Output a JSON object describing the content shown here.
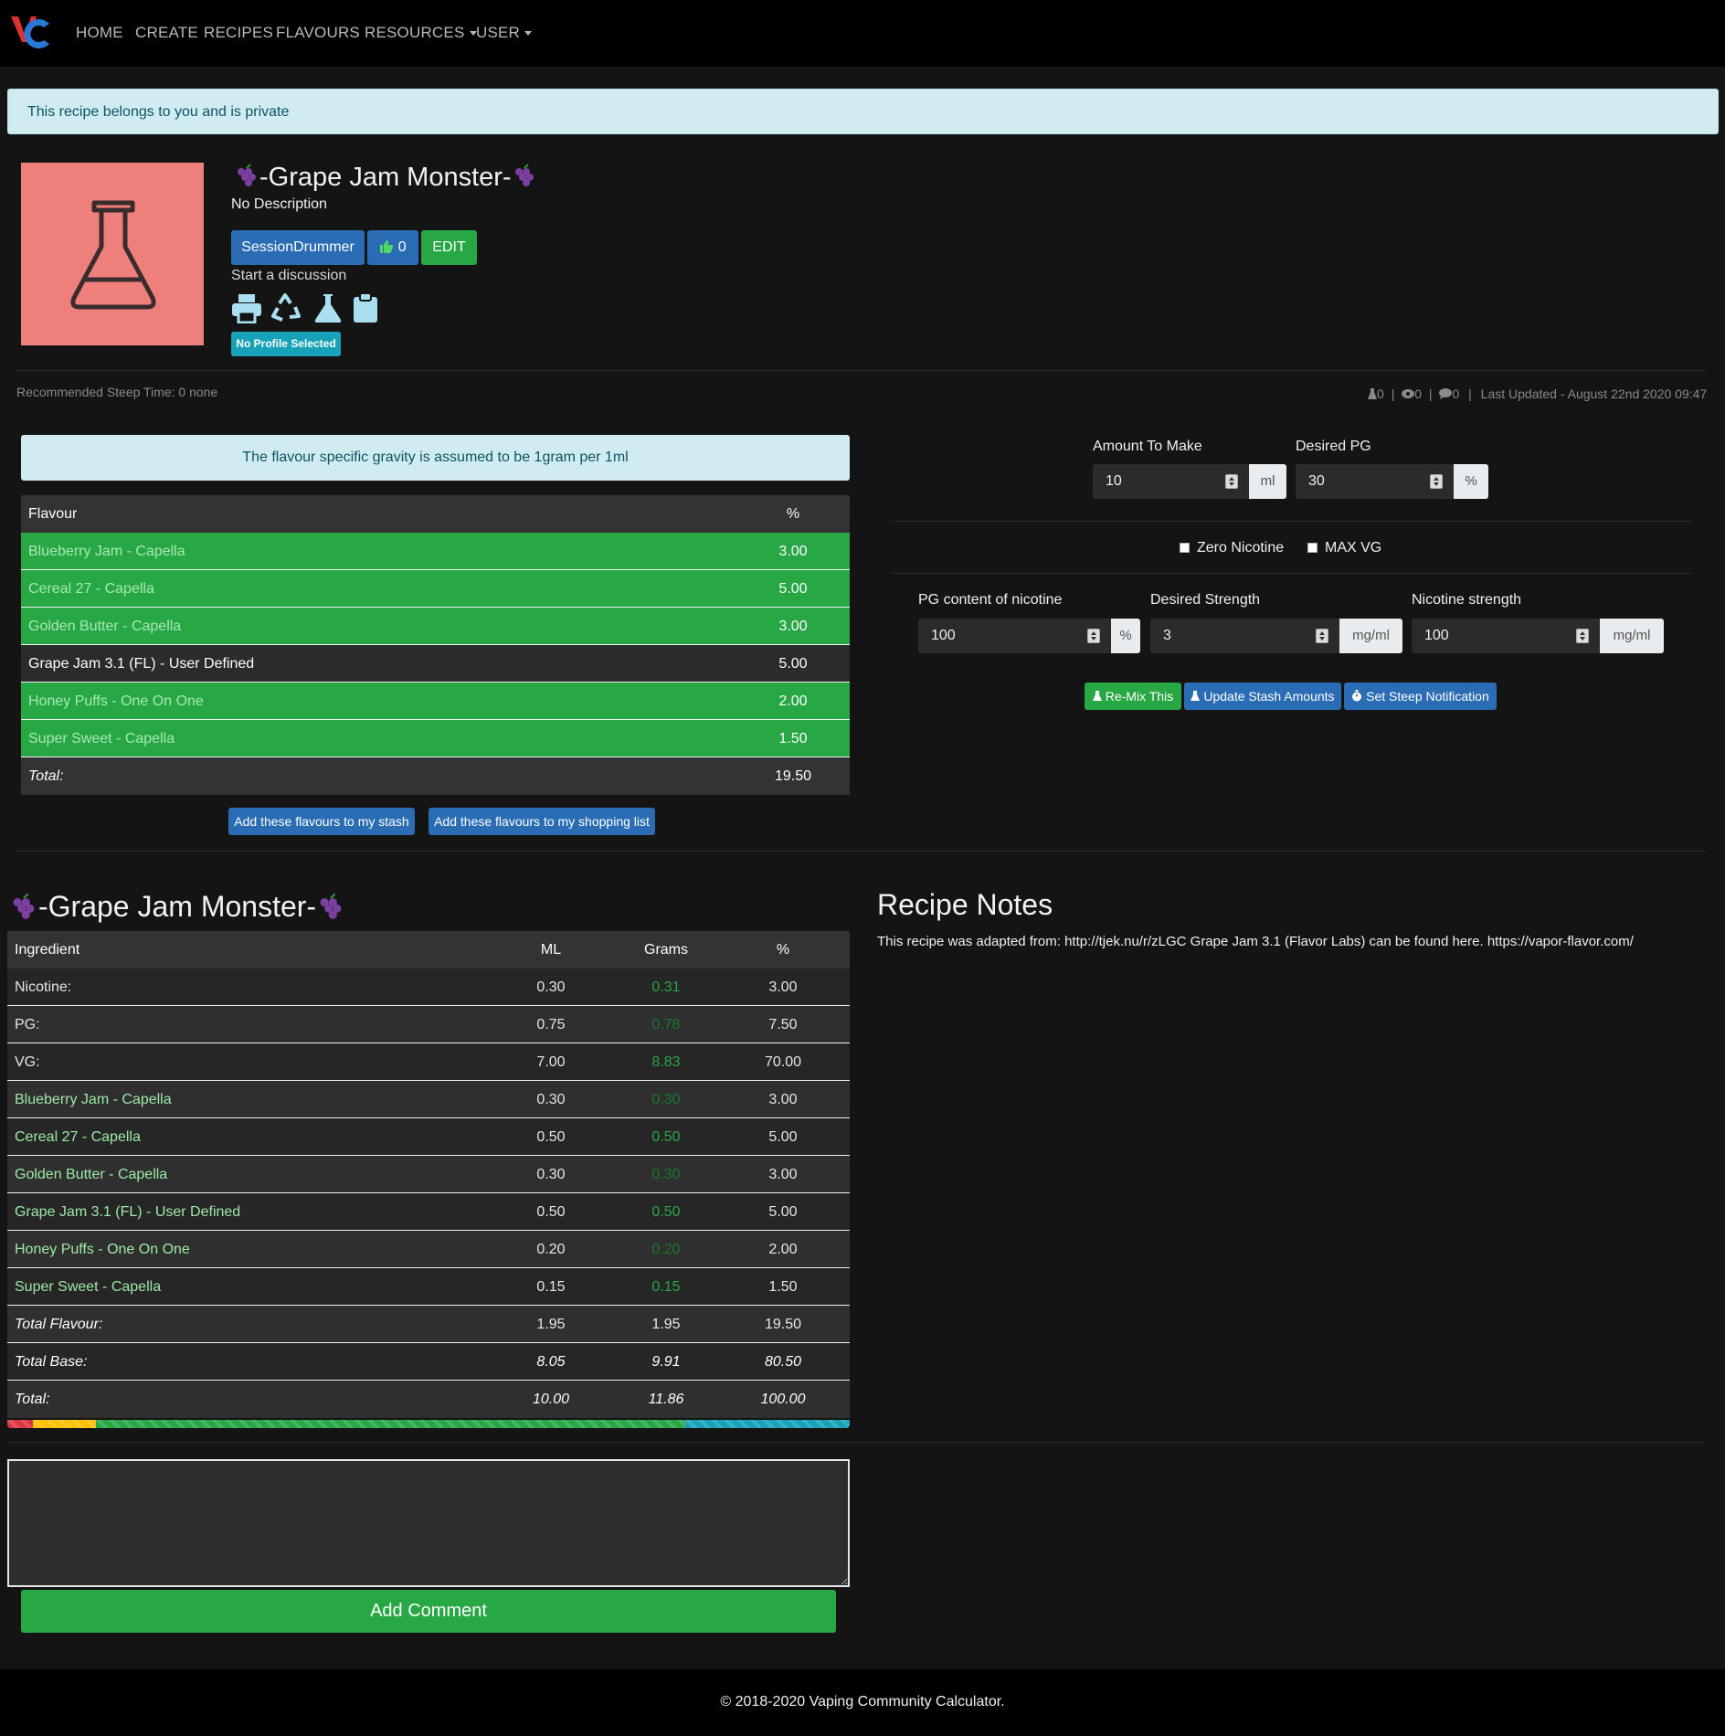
{
  "nav": {
    "items": [
      "HOME",
      "CREATE",
      "RECIPES",
      "FLAVOURS",
      "RESOURCES",
      "USER"
    ]
  },
  "alerts": {
    "private": "This recipe belongs to you and is private",
    "gravity": "The flavour specific gravity is assumed to be 1gram per 1ml"
  },
  "recipe": {
    "title": "-Grape Jam Monster-",
    "description": "No Description",
    "author": "SessionDrummer",
    "likes": "0",
    "edit_label": "EDIT",
    "discussion_link": "Start a discussion",
    "profile_badge": "No Profile Selected",
    "steep_time": "Recommended Steep Time: 0 none",
    "stats": {
      "made": "0",
      "views": "0",
      "comments": "0"
    },
    "last_updated": "Last Updated - August 22nd 2020 09:47"
  },
  "flavour_table": {
    "headers": [
      "Flavour",
      "%"
    ],
    "rows": [
      {
        "name": "Blueberry Jam - Capella",
        "pct": "3.00",
        "in_stash": true
      },
      {
        "name": "Cereal 27 - Capella",
        "pct": "5.00",
        "in_stash": true
      },
      {
        "name": "Golden Butter - Capella",
        "pct": "3.00",
        "in_stash": true
      },
      {
        "name": "Grape Jam 3.1 (FL) - User Defined",
        "pct": "5.00",
        "in_stash": false
      },
      {
        "name": "Honey Puffs - One On One",
        "pct": "2.00",
        "in_stash": true
      },
      {
        "name": "Super Sweet - Capella",
        "pct": "1.50",
        "in_stash": true
      }
    ],
    "total_label": "Total:",
    "total_value": "19.50",
    "add_stash_button": "Add these flavours to my stash",
    "add_shopping_button": "Add these flavours to my shopping list"
  },
  "calculator": {
    "amount_label": "Amount To Make",
    "amount_value": "10",
    "amount_unit": "ml",
    "pg_label": "Desired PG",
    "pg_value": "30",
    "pg_unit": "%",
    "zero_nicotine_label": "Zero Nicotine",
    "max_vg_label": "MAX VG",
    "nic_pg_label": "PG content of nicotine",
    "nic_pg_value": "100",
    "nic_pg_unit": "%",
    "strength_label": "Desired Strength",
    "strength_value": "3",
    "strength_unit": "mg/ml",
    "nic_strength_label": "Nicotine strength",
    "nic_strength_value": "100",
    "nic_strength_unit": "mg/ml",
    "remix_button": "Re-Mix This",
    "update_stash_button": "Update Stash Amounts",
    "steep_button": "Set Steep Notification"
  },
  "ingredients": {
    "title": "-Grape Jam Monster-",
    "headers": [
      "Ingredient",
      "ML",
      "Grams",
      "%"
    ],
    "base_rows": [
      {
        "name": "Nicotine:",
        "ml": "0.30",
        "grams": "0.31",
        "pct": "3.00"
      },
      {
        "name": "PG:",
        "ml": "0.75",
        "grams": "0.78",
        "pct": "7.50"
      },
      {
        "name": "VG:",
        "ml": "7.00",
        "grams": "8.83",
        "pct": "70.00"
      }
    ],
    "flavour_rows": [
      {
        "name": "Blueberry Jam - Capella",
        "ml": "0.30",
        "grams": "0.30",
        "pct": "3.00"
      },
      {
        "name": "Cereal 27 - Capella",
        "ml": "0.50",
        "grams": "0.50",
        "pct": "5.00"
      },
      {
        "name": "Golden Butter - Capella",
        "ml": "0.30",
        "grams": "0.30",
        "pct": "3.00"
      },
      {
        "name": "Grape Jam 3.1 (FL) - User Defined",
        "ml": "0.50",
        "grams": "0.50",
        "pct": "5.00"
      },
      {
        "name": "Honey Puffs - One On One",
        "ml": "0.20",
        "grams": "0.20",
        "pct": "2.00"
      },
      {
        "name": "Super Sweet - Capella",
        "ml": "0.15",
        "grams": "0.15",
        "pct": "1.50"
      }
    ],
    "totals": [
      {
        "name": "Total Flavour:",
        "ml": "1.95",
        "grams": "1.95",
        "pct": "19.50"
      },
      {
        "name": "Total Base:",
        "ml": "8.05",
        "grams": "9.91",
        "pct": "80.50"
      },
      {
        "name": "Total:",
        "ml": "10.00",
        "grams": "11.86",
        "pct": "100.00"
      }
    ],
    "mix_bar": [
      {
        "pct": 3.0,
        "color": "#dc3545"
      },
      {
        "pct": 7.5,
        "color": "#ffc107"
      },
      {
        "pct": 70.0,
        "color": "#28a745"
      },
      {
        "pct": 19.5,
        "color": "#17a2b8"
      }
    ]
  },
  "notes": {
    "title": "Recipe Notes",
    "text": "This recipe was adapted from: http://tjek.nu/r/zLGC Grape Jam 3.1 (Flavor Labs) can be found here. https://vapor-flavor.com/"
  },
  "comment": {
    "placeholder": "",
    "button": "Add Comment"
  },
  "footer": {
    "text": "© 2018-2020 Vaping Community Calculator."
  }
}
